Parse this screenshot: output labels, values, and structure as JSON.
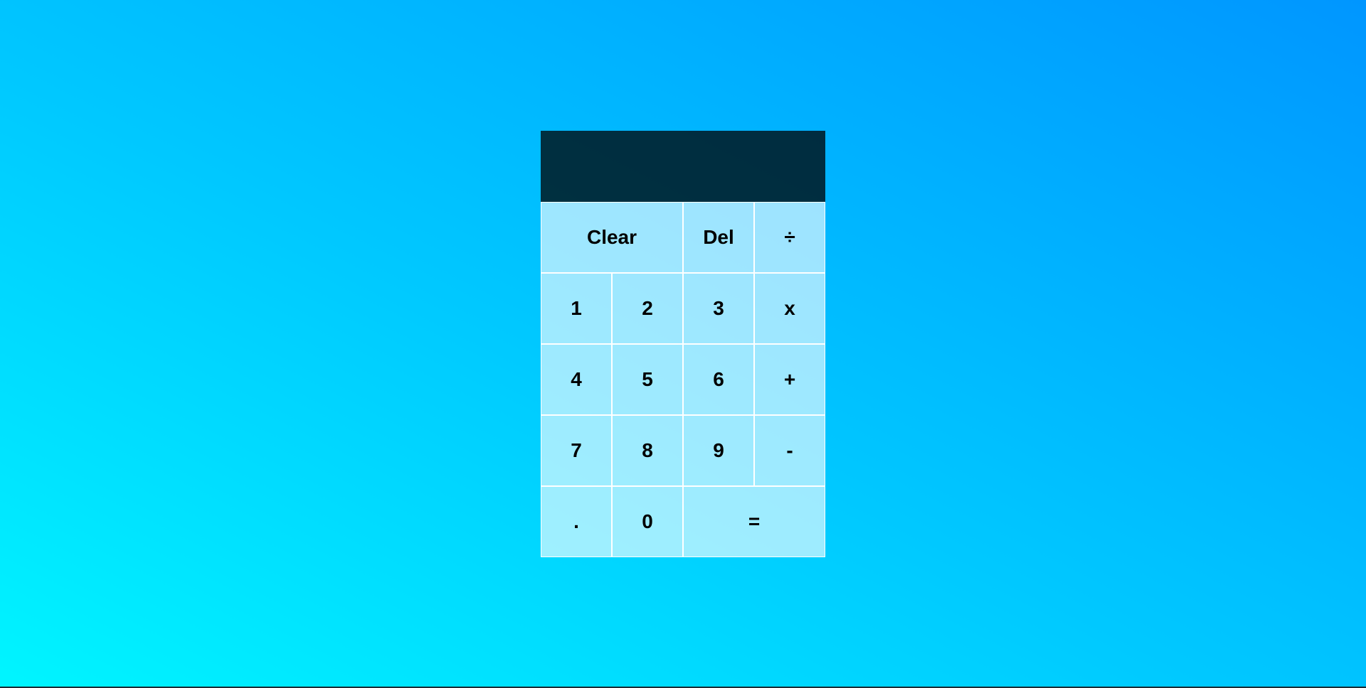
{
  "display": {
    "previous_operand": "",
    "current_operand": ""
  },
  "keys": {
    "clear": "Clear",
    "delete": "Del",
    "divide": "÷",
    "one": "1",
    "two": "2",
    "three": "3",
    "multiply": "x",
    "four": "4",
    "five": "5",
    "six": "6",
    "plus": "+",
    "seven": "7",
    "eight": "8",
    "nine": "9",
    "minus": "-",
    "decimal": ".",
    "zero": "0",
    "equals": "="
  }
}
